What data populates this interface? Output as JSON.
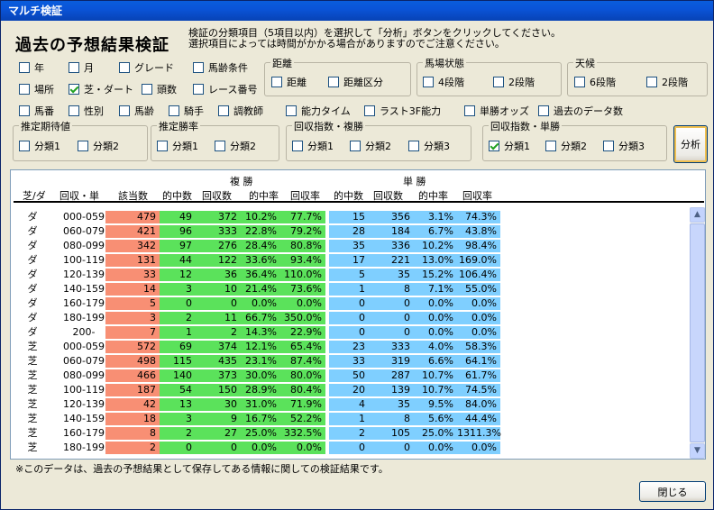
{
  "window": {
    "title": "マルチ検証"
  },
  "header": {
    "title": "過去の予想結果検証",
    "instructions": [
      "検証の分類項目（5項目以内）を選択して「分析」ボタンをクリックしてください。",
      "選択項目によっては時間がかかる場合がありますのでご注意ください。"
    ]
  },
  "options": {
    "nen": {
      "label": "年",
      "checked": false
    },
    "tsuki": {
      "label": "月",
      "checked": false
    },
    "grade": {
      "label": "グレード",
      "checked": false
    },
    "barei_joken": {
      "label": "馬齢条件",
      "checked": false
    },
    "basho": {
      "label": "場所",
      "checked": false
    },
    "shiba_dirt": {
      "label": "芝・ダート",
      "checked": true
    },
    "tosu": {
      "label": "頭数",
      "checked": false
    },
    "race_no": {
      "label": "レース番号",
      "checked": false
    },
    "umaban": {
      "label": "馬番",
      "checked": false
    },
    "seibetsu": {
      "label": "性別",
      "checked": false
    },
    "barei": {
      "label": "馬齢",
      "checked": false
    },
    "kishu": {
      "label": "騎手",
      "checked": false
    },
    "chokyoshi": {
      "label": "調教師",
      "checked": false
    },
    "noryoku_time": {
      "label": "能力タイム",
      "checked": false
    },
    "last3f": {
      "label": "ラスト3F能力",
      "checked": false
    },
    "tansho_odds": {
      "label": "単勝オッズ",
      "checked": false
    },
    "kako_data": {
      "label": "過去のデータ数",
      "checked": false
    }
  },
  "groups": {
    "kyori": {
      "label": "距離",
      "items": [
        {
          "label": "距離",
          "checked": false
        },
        {
          "label": "距離区分",
          "checked": false
        }
      ]
    },
    "baba": {
      "label": "馬場状態",
      "items": [
        {
          "label": "4段階",
          "checked": false
        },
        {
          "label": "2段階",
          "checked": false
        }
      ]
    },
    "tenko": {
      "label": "天候",
      "items": [
        {
          "label": "6段階",
          "checked": false
        },
        {
          "label": "2段階",
          "checked": false
        }
      ]
    },
    "kitaichi": {
      "label": "推定期待値",
      "items": [
        {
          "label": "分類1",
          "checked": false
        },
        {
          "label": "分類2",
          "checked": false
        }
      ]
    },
    "shoritsu": {
      "label": "推定勝率",
      "items": [
        {
          "label": "分類1",
          "checked": false
        },
        {
          "label": "分類2",
          "checked": false
        }
      ]
    },
    "kaishu_fukusho": {
      "label": "回収指数・複勝",
      "items": [
        {
          "label": "分類1",
          "checked": false
        },
        {
          "label": "分類2",
          "checked": false
        },
        {
          "label": "分類3",
          "checked": false
        }
      ]
    },
    "kaishu_tansho": {
      "label": "回収指数・単勝",
      "items": [
        {
          "label": "分類1",
          "checked": true
        },
        {
          "label": "分類2",
          "checked": false
        },
        {
          "label": "分類3",
          "checked": false
        }
      ]
    }
  },
  "buttons": {
    "analyze": "分析",
    "close": "閉じる"
  },
  "table": {
    "group_fuku": "複 勝",
    "group_tan": "単 勝",
    "columns": [
      "芝/ダ",
      "回収・単",
      "該当数",
      "的中数",
      "回収数",
      "的中率",
      "回収率",
      "的中数",
      "回収数",
      "的中率",
      "回収率"
    ],
    "rows": [
      [
        "ダ",
        "000-059",
        "479",
        "49",
        "372",
        "10.2%",
        "77.7%",
        "15",
        "356",
        "3.1%",
        "74.3%"
      ],
      [
        "ダ",
        "060-079",
        "421",
        "96",
        "333",
        "22.8%",
        "79.2%",
        "28",
        "184",
        "6.7%",
        "43.8%"
      ],
      [
        "ダ",
        "080-099",
        "342",
        "97",
        "276",
        "28.4%",
        "80.8%",
        "35",
        "336",
        "10.2%",
        "98.4%"
      ],
      [
        "ダ",
        "100-119",
        "131",
        "44",
        "122",
        "33.6%",
        "93.4%",
        "17",
        "221",
        "13.0%",
        "169.0%"
      ],
      [
        "ダ",
        "120-139",
        "33",
        "12",
        "36",
        "36.4%",
        "110.0%",
        "5",
        "35",
        "15.2%",
        "106.4%"
      ],
      [
        "ダ",
        "140-159",
        "14",
        "3",
        "10",
        "21.4%",
        "73.6%",
        "1",
        "8",
        "7.1%",
        "55.0%"
      ],
      [
        "ダ",
        "160-179",
        "5",
        "0",
        "0",
        "0.0%",
        "0.0%",
        "0",
        "0",
        "0.0%",
        "0.0%"
      ],
      [
        "ダ",
        "180-199",
        "3",
        "2",
        "11",
        "66.7%",
        "350.0%",
        "0",
        "0",
        "0.0%",
        "0.0%"
      ],
      [
        "ダ",
        "200-",
        "7",
        "1",
        "2",
        "14.3%",
        "22.9%",
        "0",
        "0",
        "0.0%",
        "0.0%"
      ],
      [
        "芝",
        "000-059",
        "572",
        "69",
        "374",
        "12.1%",
        "65.4%",
        "23",
        "333",
        "4.0%",
        "58.3%"
      ],
      [
        "芝",
        "060-079",
        "498",
        "115",
        "435",
        "23.1%",
        "87.4%",
        "33",
        "319",
        "6.6%",
        "64.1%"
      ],
      [
        "芝",
        "080-099",
        "466",
        "140",
        "373",
        "30.0%",
        "80.0%",
        "50",
        "287",
        "10.7%",
        "61.7%"
      ],
      [
        "芝",
        "100-119",
        "187",
        "54",
        "150",
        "28.9%",
        "80.4%",
        "20",
        "139",
        "10.7%",
        "74.5%"
      ],
      [
        "芝",
        "120-139",
        "42",
        "13",
        "30",
        "31.0%",
        "71.9%",
        "4",
        "35",
        "9.5%",
        "84.0%"
      ],
      [
        "芝",
        "140-159",
        "18",
        "3",
        "9",
        "16.7%",
        "52.2%",
        "1",
        "8",
        "5.6%",
        "44.4%"
      ],
      [
        "芝",
        "160-179",
        "8",
        "2",
        "27",
        "25.0%",
        "332.5%",
        "2",
        "105",
        "25.0%",
        "1311.3%"
      ],
      [
        "芝",
        "180-199",
        "2",
        "0",
        "0",
        "0.0%",
        "0.0%",
        "0",
        "0",
        "0.0%",
        "0.0%"
      ]
    ]
  },
  "footnote": "※このデータは、過去の予想結果として保存してある情報に関しての検証結果です。"
}
